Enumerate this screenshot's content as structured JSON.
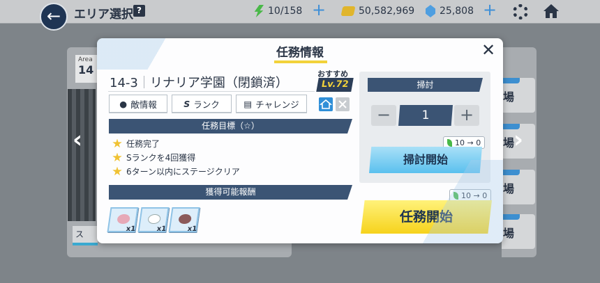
{
  "topbar": {
    "title": "エリア選択",
    "help": "?",
    "ap": "10/158",
    "credits": "50,582,969",
    "gems": "25,808",
    "plus": "+"
  },
  "background": {
    "area_label": "Area",
    "area_number": "14",
    "bottom_strip": "ス",
    "side_cards": [
      "場",
      "場",
      "場",
      "場",
      "場"
    ],
    "prev_arrow": "‹",
    "next_arrow": "›"
  },
  "modal": {
    "title": "任務情報",
    "close": "✕",
    "stage_code": "14-3",
    "stage_name": "リナリア学園（閉鎖済）",
    "recommend_label": "おすすめ",
    "recommend_level": "Lv.72",
    "tabs": [
      {
        "icon": "●",
        "label": "敵情報"
      },
      {
        "icon": "S",
        "label": "ランク"
      },
      {
        "icon": "▤",
        "label": "チャレンジ"
      }
    ],
    "objectives_header": "任務目標（☆）",
    "objectives": [
      "任務完了",
      "Sランクを4回獲得",
      "6ターン以内にステージクリア"
    ],
    "rewards_header": "獲得可能報酬",
    "rewards": [
      {
        "count": "x1",
        "color": "#e7a9b7"
      },
      {
        "count": "x1",
        "color": "#ffffff"
      },
      {
        "count": "x1",
        "color": "#8b5a5a"
      }
    ],
    "sweep": {
      "header": "掃討",
      "minus": "−",
      "plus": "+",
      "count": "1",
      "cost": "10 → 0",
      "button": "掃討開始"
    },
    "mission": {
      "cost": "10 → 0",
      "button": "任務開始"
    }
  }
}
